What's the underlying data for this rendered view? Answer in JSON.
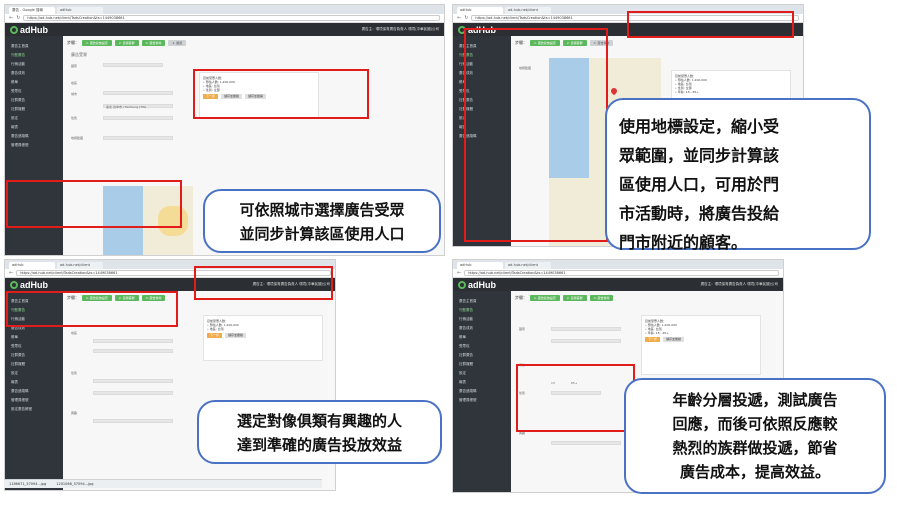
{
  "browser": {
    "url": "https://ad-hub.net/client/TadsCreation&ts=1449038661",
    "tabs": [
      "廣告 - Google 搜尋",
      "adHub",
      "ad-hub.net/client"
    ]
  },
  "app": {
    "logo_text": "adHub",
    "account": "廣告主：環境保育廣告負責人 環境(中華民國)公司",
    "user_icon": "user-icon"
  },
  "wizard": {
    "step_prefix": "步驟：",
    "steps": [
      "1. 廣告投放設定",
      "2. 目標客群",
      "3. 廣告素材",
      "4. 確認"
    ]
  },
  "sidebar": {
    "items": [
      "廣告主首頁",
      "刊登廣告",
      "行銷活動",
      "廣告成效",
      "帳單",
      "受眾包",
      "社群廣告",
      "社群媒體",
      "設定",
      "報表",
      "廣告追蹤碼",
      "管理員帳號",
      "設定廣告帳號"
    ]
  },
  "form": {
    "section_title": "廣告受眾",
    "region_label": "地區",
    "country_label": "國家",
    "city_label": "城市",
    "gender_label": "性別",
    "age_label": "年齡",
    "interest_label": "興趣",
    "map_label": "地標範圍",
    "country_value": "台灣",
    "city_value": "臺北 台中市 / Taichung (TW)",
    "age_from": "13",
    "age_to": "65+"
  },
  "summary": {
    "title": "目前受眾人數：",
    "lines": [
      "• 預估人數: 1,200,000",
      "• 地區: 台灣",
      "• 性別: 全部",
      "• 年齡: 18 - 65+"
    ],
    "buttons": [
      "下一步",
      "儲存並繼續",
      "儲存並離開"
    ]
  },
  "callouts": {
    "c1": [
      "可依照城市選擇廣告受眾",
      "並同步計算該區使用人口"
    ],
    "c2": [
      "使用地標設定，縮小受",
      "眾範圍，並同步計算該",
      "區使用人口，可用於門",
      "市活動時，將廣告投給",
      "門市附近的顧客。"
    ],
    "c3": [
      "選定對像俱類有興趣的人",
      "達到準確的廣告投放效益"
    ],
    "c4": [
      "年齡分層投遞，測試廣告",
      "回應，而後可依照反應較",
      "熱烈的族群做投遞，節省",
      "廣告成本，提高效益。"
    ]
  },
  "taskbar": {
    "files": [
      "1186671_57094...jpg",
      "1201066_57094...jpg"
    ]
  },
  "colors": {
    "highlight": "#e21b1b",
    "callout_border": "#4a72c4",
    "app_header": "#2b2f33",
    "accent": "#5cb85c"
  }
}
